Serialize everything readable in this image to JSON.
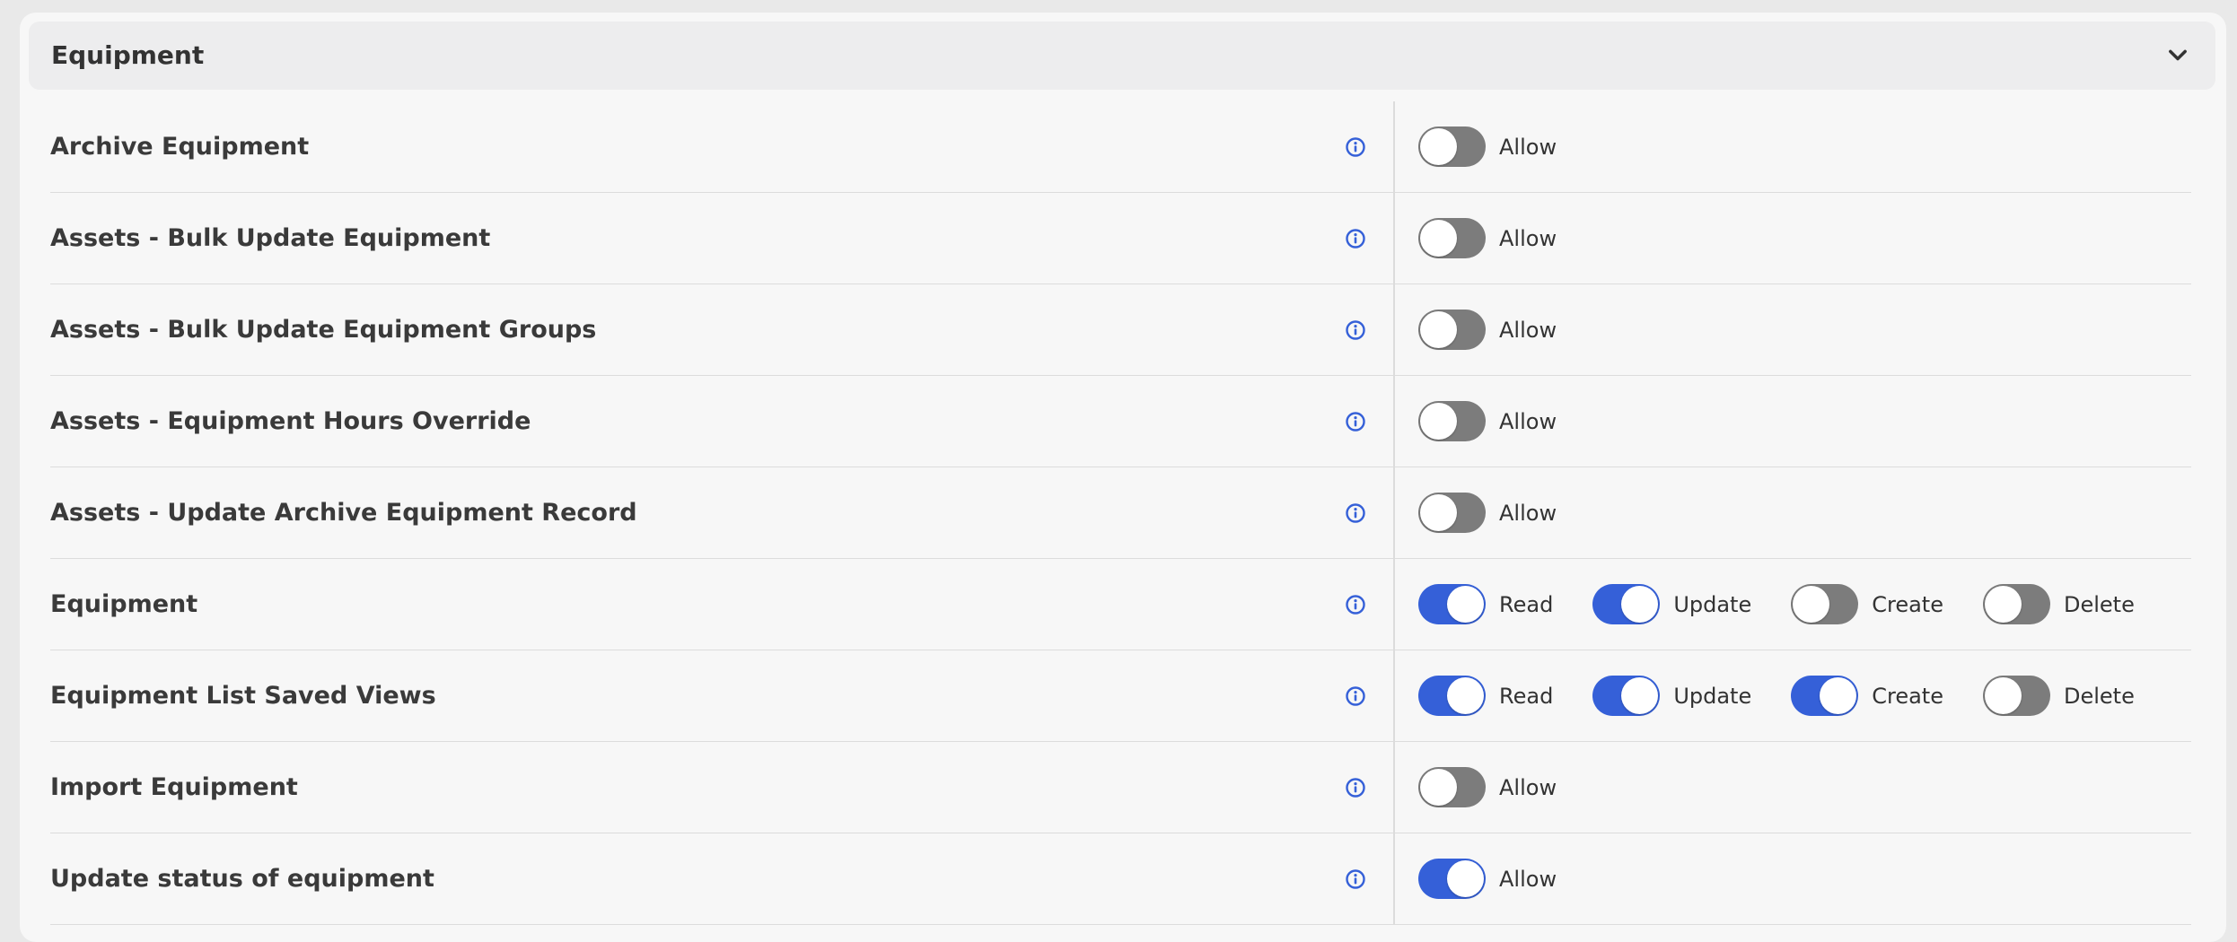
{
  "section": {
    "title": "Equipment"
  },
  "colors": {
    "accent": "#3560d8",
    "toggle_off": "#7c7c7c",
    "info_icon": "#3560d8"
  },
  "rows": [
    {
      "label": "Archive Equipment",
      "perms": [
        {
          "label": "Allow",
          "on": false
        }
      ]
    },
    {
      "label": "Assets - Bulk Update Equipment",
      "perms": [
        {
          "label": "Allow",
          "on": false
        }
      ]
    },
    {
      "label": "Assets - Bulk Update Equipment Groups",
      "perms": [
        {
          "label": "Allow",
          "on": false
        }
      ]
    },
    {
      "label": "Assets - Equipment Hours Override",
      "perms": [
        {
          "label": "Allow",
          "on": false
        }
      ]
    },
    {
      "label": "Assets - Update Archive Equipment Record",
      "perms": [
        {
          "label": "Allow",
          "on": false
        }
      ]
    },
    {
      "label": "Equipment",
      "perms": [
        {
          "label": "Read",
          "on": true
        },
        {
          "label": "Update",
          "on": true
        },
        {
          "label": "Create",
          "on": false
        },
        {
          "label": "Delete",
          "on": false
        }
      ]
    },
    {
      "label": "Equipment List Saved Views",
      "perms": [
        {
          "label": "Read",
          "on": true
        },
        {
          "label": "Update",
          "on": true
        },
        {
          "label": "Create",
          "on": true
        },
        {
          "label": "Delete",
          "on": false
        }
      ]
    },
    {
      "label": "Import Equipment",
      "perms": [
        {
          "label": "Allow",
          "on": false
        }
      ]
    },
    {
      "label": "Update status of equipment",
      "perms": [
        {
          "label": "Allow",
          "on": true
        }
      ]
    }
  ]
}
